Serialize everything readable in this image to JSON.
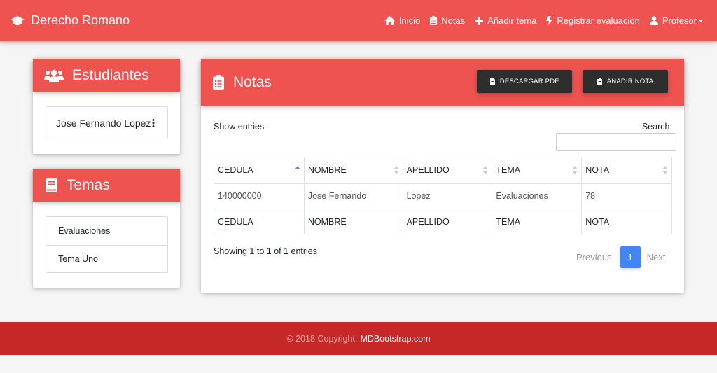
{
  "colors": {
    "accent": "#ef5350",
    "footer": "#c62828",
    "button_dark": "#2e2e2e",
    "pagination_active": "#4285f4"
  },
  "navbar": {
    "brand": "Derecho Romano",
    "brand_icon": "graduation-cap-icon",
    "items": [
      {
        "label": "Inicio",
        "icon": "home-icon"
      },
      {
        "label": "Notas",
        "icon": "clipboard-icon"
      },
      {
        "label": "Añadir tema",
        "icon": "plus-icon"
      },
      {
        "label": "Registrar evaluación",
        "icon": "bolt-icon"
      },
      {
        "label": "Profesor",
        "icon": "user-icon"
      }
    ]
  },
  "estudiantes": {
    "title": "Estudiantes",
    "icon": "users-icon",
    "items": [
      {
        "label": "Jose Fernando Lopez"
      }
    ]
  },
  "temas": {
    "title": "Temas",
    "icon": "book-icon",
    "items": [
      {
        "label": "Evaluaciones"
      },
      {
        "label": "Tema Uno"
      }
    ]
  },
  "notas": {
    "title": "Notas",
    "icon": "clipboard-list-icon",
    "download_label": "DESCARGAR PDF",
    "add_label": "AÑADIR NOTA",
    "show_entries": "Show entries",
    "search_label": "Search:",
    "search_value": "",
    "columns": [
      "CEDULA",
      "NOMBRE",
      "APELLIDO",
      "TEMA",
      "NOTA"
    ],
    "rows": [
      [
        "140000000",
        "Jose Fernando",
        "Lopez",
        "Evaluaciones",
        "78"
      ]
    ],
    "info": "Showing 1 to 1 of 1 entries",
    "pagination": {
      "previous": "Previous",
      "current": "1",
      "next": "Next"
    }
  },
  "footer": {
    "copyright": "© 2018 Copyright:",
    "link": "MDBootstrap.com"
  }
}
